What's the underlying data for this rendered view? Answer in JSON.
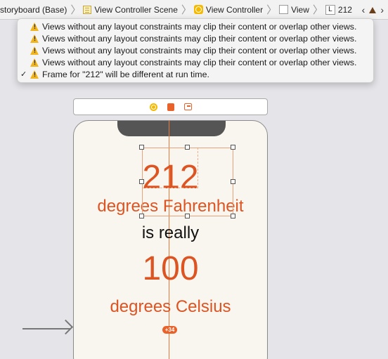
{
  "jumpbar": {
    "items": [
      {
        "label": "storyboard (Base)",
        "icon": "storyboard-icon"
      },
      {
        "label": "View Controller Scene",
        "icon": "scene-icon"
      },
      {
        "label": "View Controller",
        "icon": "view-controller-icon"
      },
      {
        "label": "View",
        "icon": "view-icon"
      },
      {
        "label": "212",
        "icon": "label-icon",
        "icon_text": "L"
      }
    ]
  },
  "issues": {
    "items": [
      {
        "type": "warning",
        "text": "Views without any layout constraints may clip their content or overlap other views."
      },
      {
        "type": "warning",
        "text": "Views without any layout constraints may clip their content or overlap other views."
      },
      {
        "type": "warning",
        "text": "Views without any layout constraints may clip their content or overlap other views."
      },
      {
        "type": "warning",
        "text": "Views without any layout constraints may clip their content or overlap other views."
      },
      {
        "type": "warning",
        "text": "Frame for \"212\" will be different at run time.",
        "checked": true
      }
    ]
  },
  "scene": {
    "fahrenheit_value": "212",
    "fahrenheit_unit": "degrees Fahrenheit",
    "connector": "is really",
    "celsius_value": "100",
    "celsius_unit": "degrees Celsius",
    "spacing_badge": "+34"
  },
  "colors": {
    "accent": "#dc5422",
    "guide": "#e8783c",
    "warning": "#f0b41c"
  }
}
